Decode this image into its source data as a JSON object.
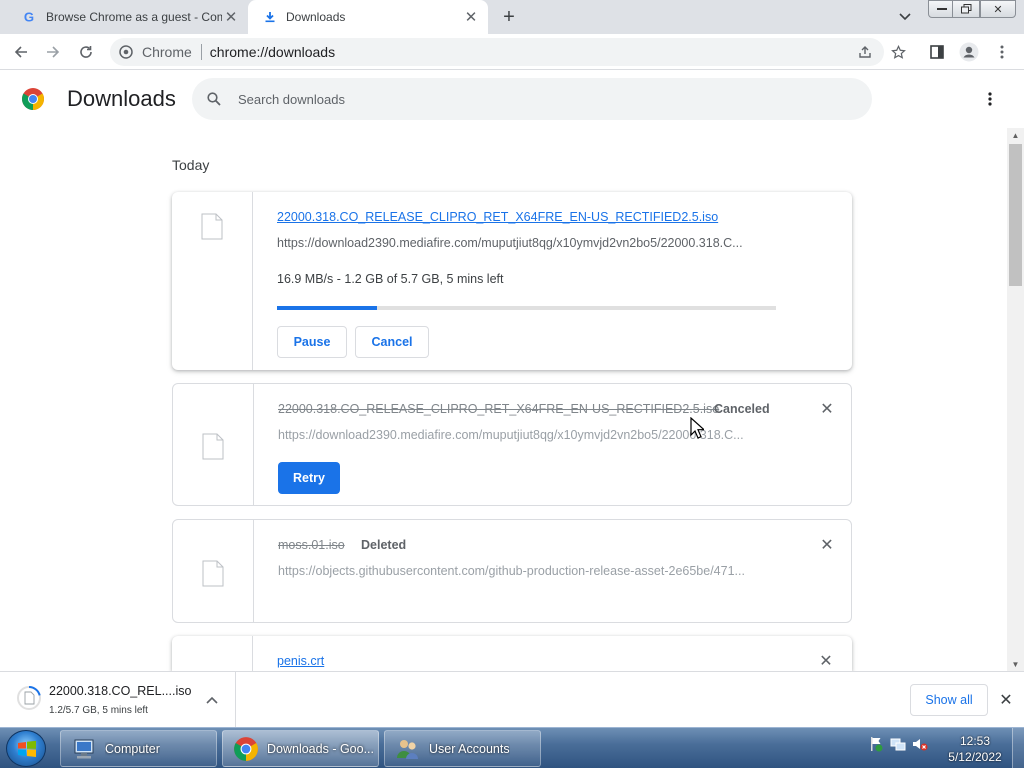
{
  "tabs": [
    {
      "title": "Browse Chrome as a guest - Com",
      "active": false,
      "icon": "google-icon"
    },
    {
      "title": "Downloads",
      "active": true,
      "icon": "download-icon"
    }
  ],
  "omnibox": {
    "chip": "Chrome",
    "url": "chrome://downloads"
  },
  "header": {
    "title": "Downloads",
    "search_placeholder": "Search downloads"
  },
  "list": {
    "section": "Today",
    "items": [
      {
        "name": "22000.318.CO_RELEASE_CLIPRO_RET_X64FRE_EN-US_RECTIFIED2.5.iso",
        "url": "https://download2390.mediafire.com/muputjiut8qg/x10ymvjd2vn2bo5/22000.318.C...",
        "progress_text": "16.9 MB/s - 1.2 GB of 5.7 GB, 5 mins left",
        "progress_fraction": 0.2,
        "buttons": [
          "Pause",
          "Cancel"
        ]
      },
      {
        "name": "22000.318.CO_RELEASE_CLIPRO_RET_X64FRE_EN-US_RECTIFIED2.5.iso",
        "status": "Canceled",
        "url": "https://download2390.mediafire.com/muputjiut8qg/x10ymvjd2vn2bo5/22000.318.C...",
        "button": "Retry"
      },
      {
        "name": "moss.01.iso",
        "status": "Deleted",
        "url": "https://objects.githubusercontent.com/github-production-release-asset-2e65be/471..."
      },
      {
        "name": "penis.crt"
      }
    ]
  },
  "shelf": {
    "item_name": "22000.318.CO_REL....iso",
    "item_sub": "1.2/5.7 GB, 5 mins left",
    "item_progress_fraction": 0.21,
    "show_all": "Show all"
  },
  "taskbar": {
    "tasks": [
      {
        "label": "Computer",
        "icon": "computer-icon"
      },
      {
        "label": "Downloads - Goo...",
        "icon": "chrome-icon"
      },
      {
        "label": "User Accounts",
        "icon": "user-accounts-icon"
      }
    ],
    "time": "12:53",
    "date": "5/12/2022"
  },
  "colors": {
    "accent": "#1a73e8",
    "tab_strip": "#dee1e6",
    "taskbar": "#2f5380"
  }
}
